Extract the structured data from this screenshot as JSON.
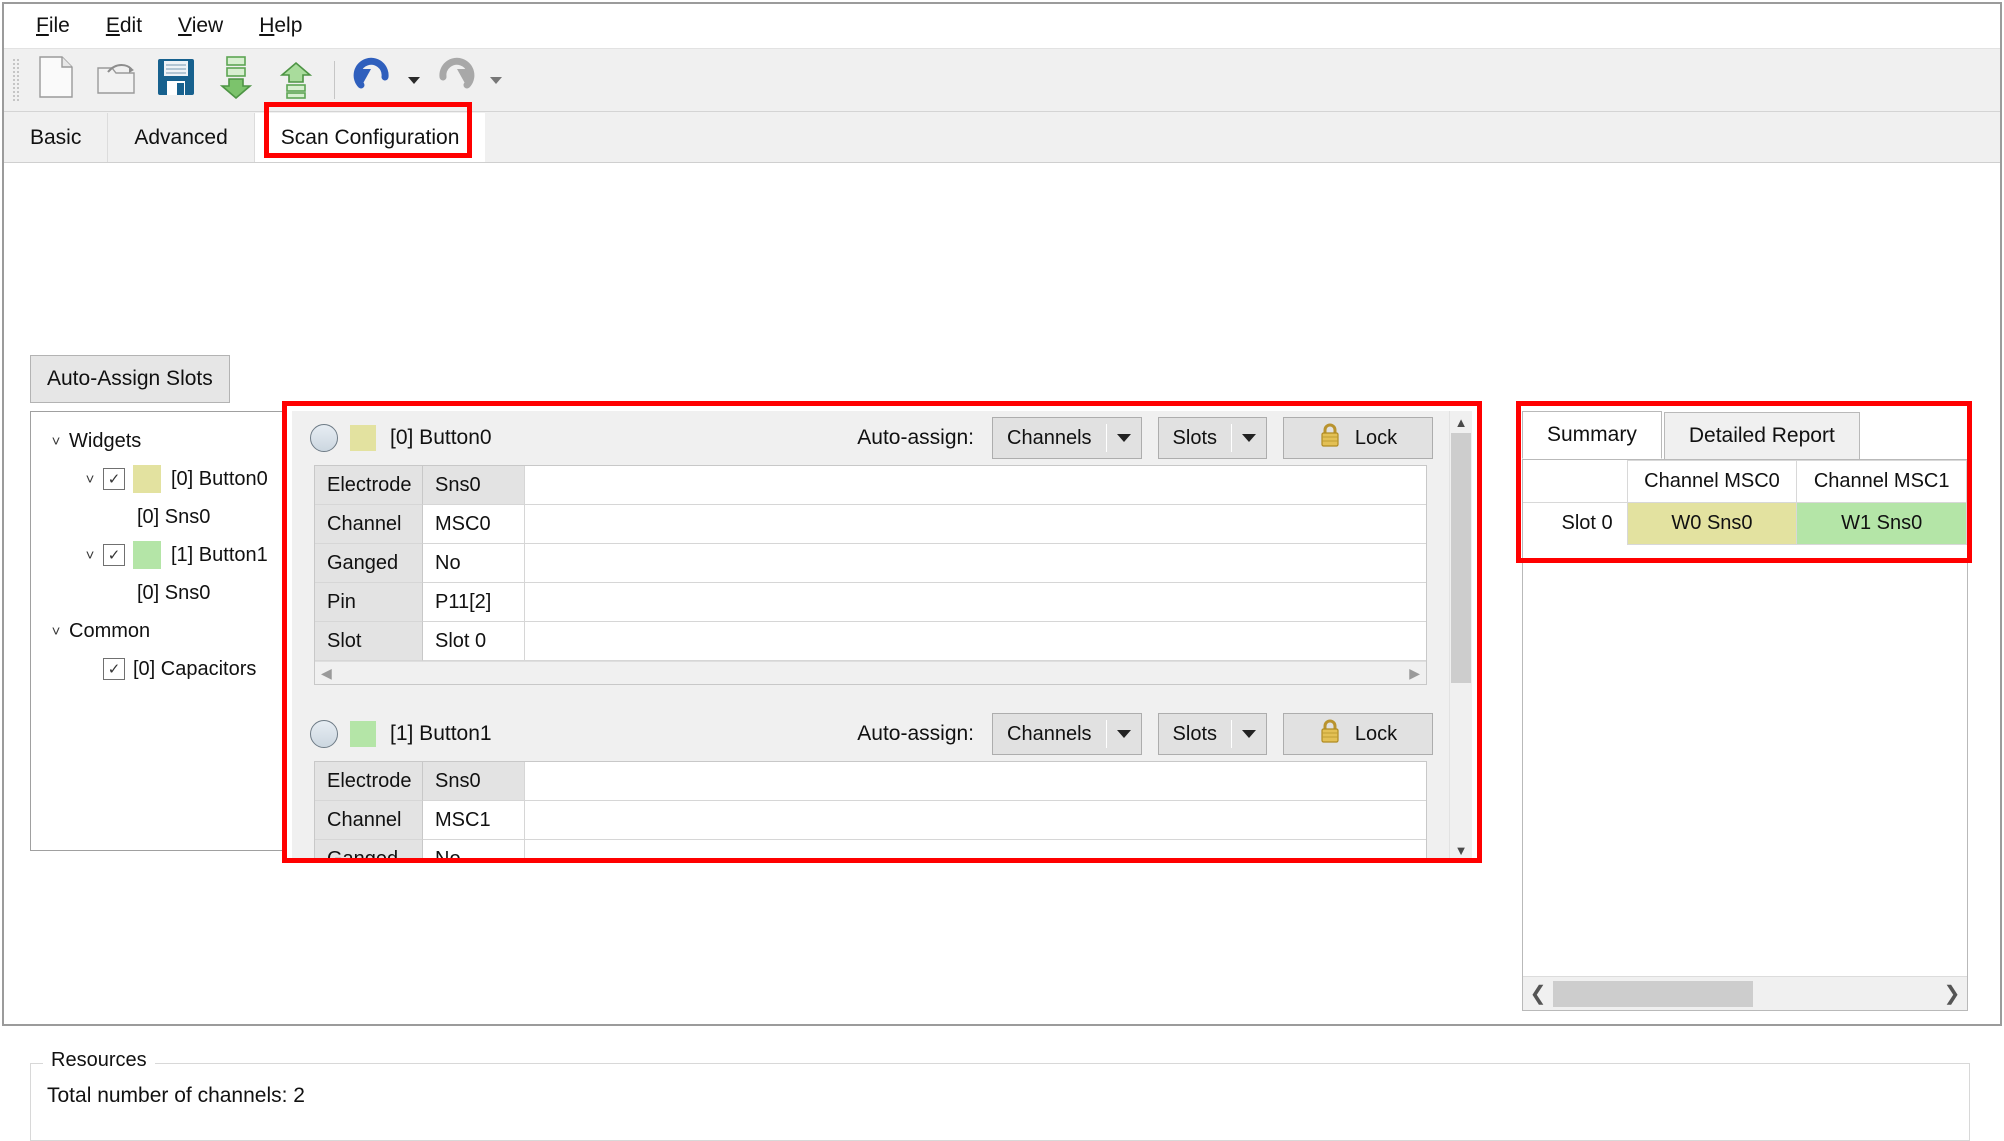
{
  "window": {
    "menu": [
      {
        "label": "File",
        "mnemonic": "F"
      },
      {
        "label": "Edit",
        "mnemonic": "E"
      },
      {
        "label": "View",
        "mnemonic": "V"
      },
      {
        "label": "Help",
        "mnemonic": "H"
      }
    ]
  },
  "toolbar": {
    "buttons": [
      {
        "name": "new-file-icon",
        "tooltip": "New"
      },
      {
        "name": "open-folder-icon",
        "tooltip": "Open"
      },
      {
        "name": "save-floppy-icon",
        "tooltip": "Save"
      },
      {
        "name": "import-down-arrow-icon",
        "tooltip": "Import"
      },
      {
        "name": "export-up-arrow-icon",
        "tooltip": "Export"
      },
      {
        "name": "undo-icon",
        "tooltip": "Undo"
      },
      {
        "name": "redo-icon",
        "tooltip": "Redo"
      }
    ]
  },
  "tabs": [
    {
      "label": "Basic",
      "active": false
    },
    {
      "label": "Advanced",
      "active": false
    },
    {
      "label": "Scan Configuration",
      "active": true
    }
  ],
  "actions": {
    "auto_assign_slots": "Auto-Assign Slots"
  },
  "tree": {
    "nodes": [
      {
        "label": "Widgets",
        "level": 0,
        "chevron": "˅",
        "checkbox": null,
        "swatch": null
      },
      {
        "label": "[0] Button0",
        "level": 1,
        "chevron": "˅",
        "checkbox": "checked",
        "swatch": "#e3e2a0"
      },
      {
        "label": "[0] Sns0",
        "level": 2,
        "chevron": null,
        "checkbox": null,
        "swatch": null
      },
      {
        "label": "[1] Button1",
        "level": 1,
        "chevron": "˅",
        "checkbox": "checked",
        "swatch": "#b4e5a7"
      },
      {
        "label": "[0] Sns0",
        "level": 2,
        "chevron": null,
        "checkbox": null,
        "swatch": null
      },
      {
        "label": "Common",
        "level": 0,
        "chevron": "˅",
        "checkbox": null,
        "swatch": null
      },
      {
        "label": "[0] Capacitors",
        "level": 1,
        "chevron": null,
        "checkbox": "checked",
        "swatch": null
      }
    ]
  },
  "widgets": [
    {
      "name": "[0] Button0",
      "swatch": "#e3e2a0",
      "auto_assign_label": "Auto-assign:",
      "channels_combo": "Channels",
      "slots_combo": "Slots",
      "lock_label": "Lock",
      "properties": [
        {
          "key": "Electrode",
          "value": "Sns0",
          "selected": true
        },
        {
          "key": "Channel",
          "value": "MSC0",
          "selected": false
        },
        {
          "key": "Ganged",
          "value": "No",
          "selected": false
        },
        {
          "key": "Pin",
          "value": "P11[2]",
          "selected": false
        },
        {
          "key": "Slot",
          "value": "Slot 0",
          "selected": false
        }
      ]
    },
    {
      "name": "[1] Button1",
      "swatch": "#b4e5a7",
      "auto_assign_label": "Auto-assign:",
      "channels_combo": "Channels",
      "slots_combo": "Slots",
      "lock_label": "Lock",
      "properties": [
        {
          "key": "Electrode",
          "value": "Sns0",
          "selected": true
        },
        {
          "key": "Channel",
          "value": "MSC1",
          "selected": false
        },
        {
          "key": "Ganged",
          "value": "No",
          "selected": false
        }
      ]
    }
  ],
  "report": {
    "tabs": [
      {
        "label": "Summary",
        "active": true
      },
      {
        "label": "Detailed Report",
        "active": false
      }
    ],
    "table": {
      "corner": "",
      "columns": [
        "Channel MSC0",
        "Channel MSC1"
      ],
      "rows": [
        {
          "header": "Slot 0",
          "cells": [
            {
              "text": "W0 Sns0",
              "color": "#e3e2a0"
            },
            {
              "text": "W1 Sns0",
              "color": "#b4e5a7"
            }
          ]
        }
      ]
    }
  },
  "resources": {
    "legend": "Resources",
    "text": "Total number of channels: 2"
  },
  "colors": {
    "highlight": "#ff0000",
    "widget0": "#e3e2a0",
    "widget1": "#b4e5a7",
    "toolbar_bg": "#f0f0f0",
    "lock_gold": "#d4a937"
  }
}
